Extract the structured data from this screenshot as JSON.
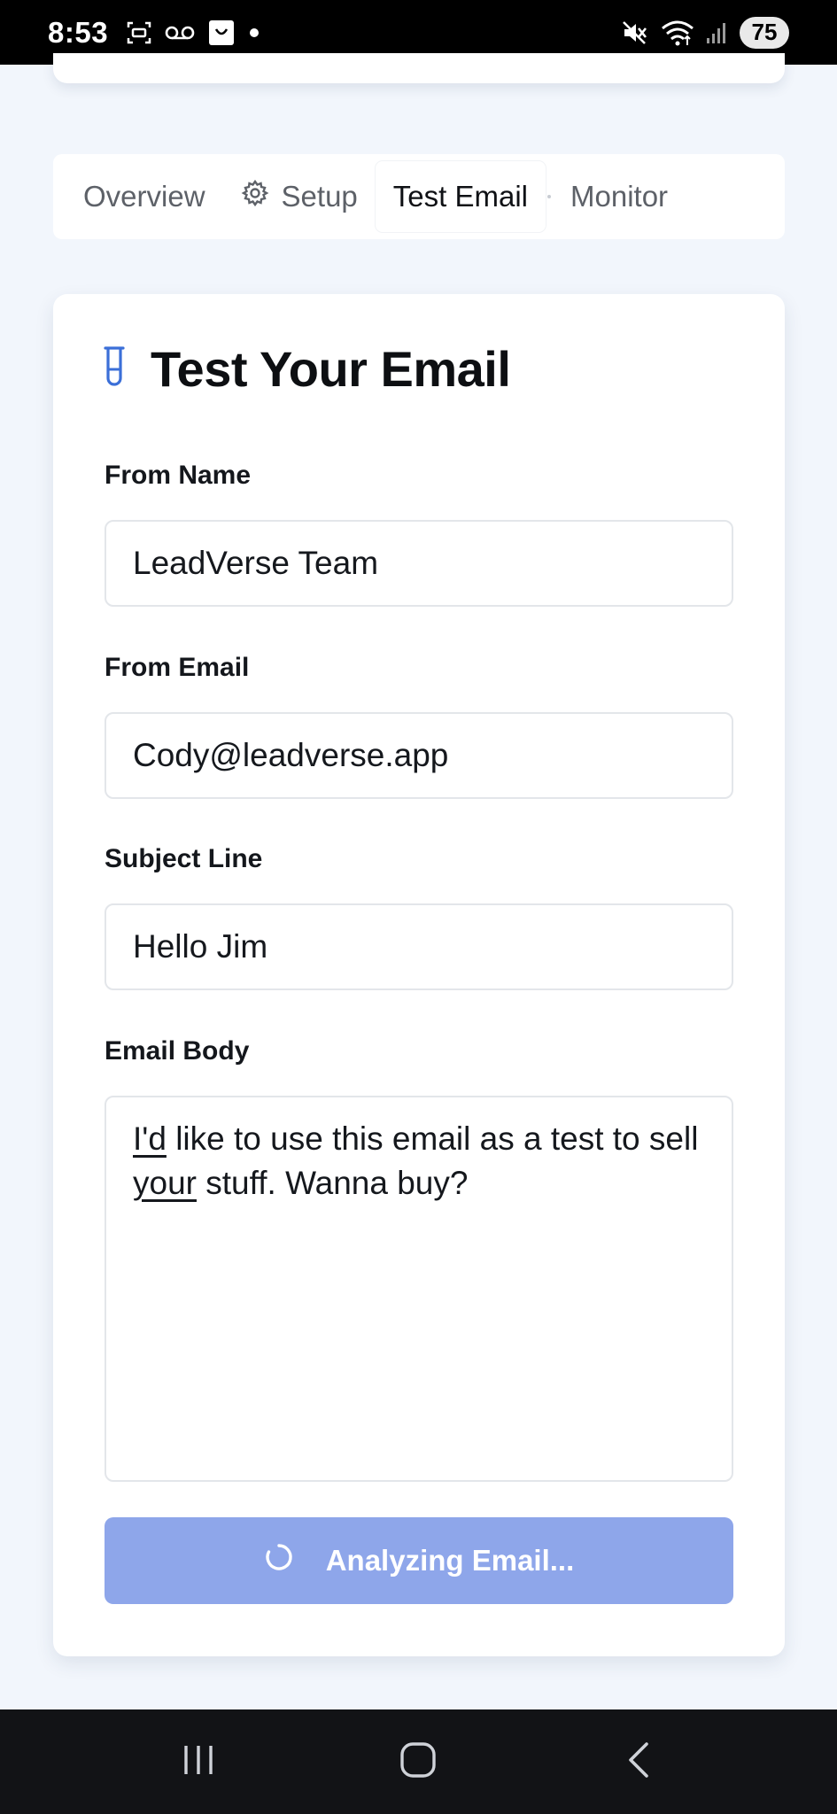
{
  "status_bar": {
    "time": "8:53",
    "battery": "75",
    "left_icons": [
      "screenshot-icon",
      "voicemail-icon",
      "shopping-bag-icon",
      "notification-dot-icon"
    ],
    "right_icons": [
      "mute-icon",
      "wifi-icon",
      "signal-icon"
    ]
  },
  "tabs": [
    {
      "label": "Overview",
      "active": false
    },
    {
      "label": "Setup",
      "active": false,
      "icon": "gear-icon"
    },
    {
      "label": "Test Email",
      "active": true
    },
    {
      "label": "Monitor",
      "active": false
    }
  ],
  "card": {
    "icon": "test-tube-icon",
    "title": "Test Your Email",
    "accent_color": "#3b6fd8",
    "fields": {
      "from_name": {
        "label": "From Name",
        "value": "LeadVerse Team"
      },
      "from_email": {
        "label": "From Email",
        "value": "Cody@leadverse.app"
      },
      "subject": {
        "label": "Subject Line",
        "value": "Hello Jim"
      },
      "body": {
        "label": "Email Body",
        "parts": [
          "I'd",
          " like to use this email as a test to sell ",
          "your",
          " stuff. Wanna buy?"
        ]
      }
    },
    "button": {
      "label": "Analyzing Email...",
      "color": "#8ea6ea",
      "icon": "spinner-icon"
    }
  },
  "nav_bar": {
    "icons": [
      "recent-apps-icon",
      "home-icon",
      "back-icon"
    ]
  }
}
